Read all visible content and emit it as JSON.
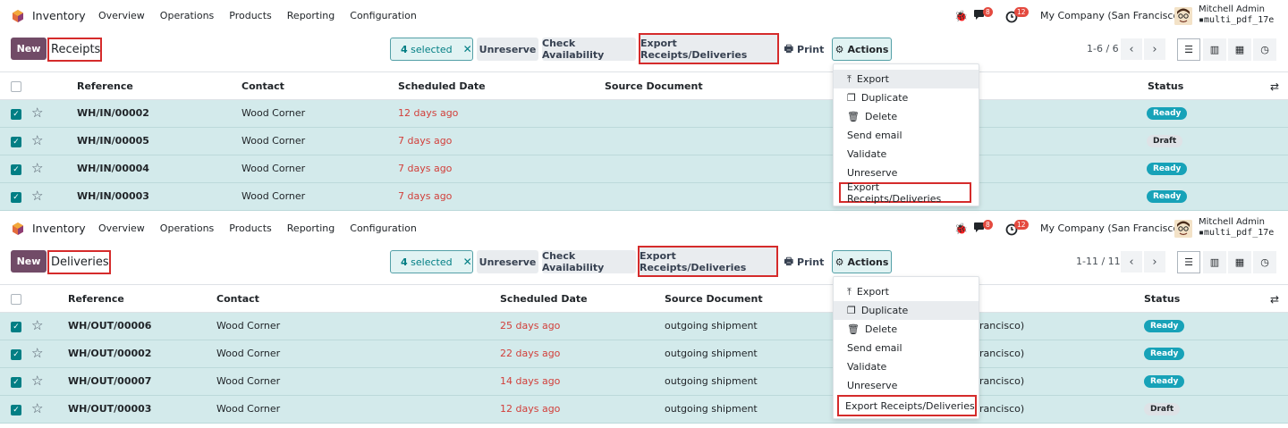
{
  "colors": {
    "brand": "#714b67",
    "accent": "#017e84",
    "danger": "#d23f3a",
    "row_selected": "#d3eaeb"
  },
  "navbar": {
    "app_name": "Inventory",
    "menu": [
      "Overview",
      "Operations",
      "Products",
      "Reporting",
      "Configuration"
    ],
    "chat_badge": "8",
    "activity_badge": "12",
    "company": "My Company (San Francisco)",
    "user_name": "Mitchell Admin",
    "db_name": "multi_pdf_17e"
  },
  "controls": {
    "new_label": "New",
    "selected_count": "4",
    "selected_suffix": "selected",
    "unreserve": "Unreserve",
    "check_availability": "Check Availability",
    "export_rd": "Export Receipts/Deliveries",
    "print": "Print",
    "actions": "Actions"
  },
  "dropdown": [
    "Export",
    "Duplicate",
    "Delete",
    "Send email",
    "Validate",
    "Unreserve",
    "Export Receipts/Deliveries"
  ],
  "receipts": {
    "title": "Receipts",
    "pager": "1-6 / 6",
    "headers": {
      "reference": "Reference",
      "contact": "Contact",
      "scheduled": "Scheduled Date",
      "source": "Source Document",
      "status": "Status"
    },
    "rows": [
      {
        "ref": "WH/IN/00002",
        "contact": "Wood Corner",
        "date": "12 days ago",
        "status": "Ready"
      },
      {
        "ref": "WH/IN/00005",
        "contact": "Wood Corner",
        "date": "7 days ago",
        "status": "Draft"
      },
      {
        "ref": "WH/IN/00004",
        "contact": "Wood Corner",
        "date": "7 days ago",
        "status": "Ready"
      },
      {
        "ref": "WH/IN/00003",
        "contact": "Wood Corner",
        "date": "7 days ago",
        "status": "Ready"
      }
    ]
  },
  "deliveries": {
    "title": "Deliveries",
    "pager": "1-11 / 11",
    "headers": {
      "reference": "Reference",
      "contact": "Contact",
      "scheduled": "Scheduled Date",
      "source": "Source Document",
      "status": "Status"
    },
    "partial_text": "rancisco)",
    "rows": [
      {
        "ref": "WH/OUT/00006",
        "contact": "Wood Corner",
        "date": "25 days ago",
        "source": "outgoing shipment",
        "status": "Ready"
      },
      {
        "ref": "WH/OUT/00002",
        "contact": "Wood Corner",
        "date": "22 days ago",
        "source": "outgoing shipment",
        "status": "Ready"
      },
      {
        "ref": "WH/OUT/00007",
        "contact": "Wood Corner",
        "date": "14 days ago",
        "source": "outgoing shipment",
        "status": "Ready"
      },
      {
        "ref": "WH/OUT/00003",
        "contact": "Wood Corner",
        "date": "12 days ago",
        "source": "outgoing shipment",
        "status": "Draft"
      }
    ]
  }
}
